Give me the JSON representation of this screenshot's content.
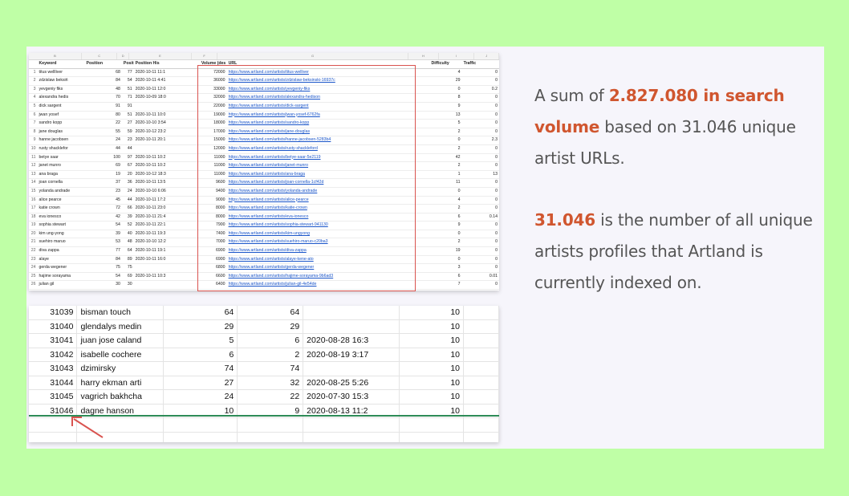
{
  "top_sheet": {
    "column_letters": [
      "B",
      "C",
      "D",
      "E",
      "F",
      "G",
      "H",
      "I",
      "J"
    ],
    "headers": [
      "Keyword",
      "Position",
      "Position His",
      "Position His",
      "Volume (des",
      "URL",
      "Difficulty",
      "Traffic",
      "C"
    ],
    "rows": [
      [
        "1",
        "titus wellliver",
        "68",
        "77",
        "2020-10-11 11:1",
        "72000",
        "https://www.artland.com/artists/titus-welliver",
        "4",
        "0"
      ],
      [
        "2",
        "zdzislaw beksiń",
        "84",
        "54",
        "2020-10-11 4:41",
        "36000",
        "https://www.artland.com/artists/zdzislaw-beksinski-16937c",
        "29",
        "0"
      ],
      [
        "3",
        "yevgeniy fiks",
        "48",
        "51",
        "2020-10-11 12:0",
        "33000",
        "https://www.artland.com/artists/yevgeniy-fiks",
        "0",
        "0.2"
      ],
      [
        "4",
        "alexandra hedis",
        "70",
        "71",
        "2020-10-09 18:0",
        "32000",
        "https://www.artland.com/artists/alexandra-hedison",
        "8",
        "0"
      ],
      [
        "5",
        "dick sargent",
        "91",
        "91",
        "",
        "22000",
        "https://www.artland.com/artists/dick-sargent",
        "9",
        "0"
      ],
      [
        "6",
        "jwan yosef",
        "80",
        "51",
        "2020-10-11 10:0",
        "19000",
        "https://www.artland.com/artists/jwan-yosef-6762fa",
        "13",
        "0"
      ],
      [
        "7",
        "sandro kopp",
        "22",
        "27",
        "2020-10-10 3:54",
        "18000",
        "https://www.artland.com/artists/sandro-kopp",
        "5",
        "0"
      ],
      [
        "8",
        "jane douglas",
        "55",
        "59",
        "2020-10-12 23:2",
        "17000",
        "https://www.artland.com/artists/jane-douglas",
        "2",
        "0"
      ],
      [
        "9",
        "hanne jacobsen",
        "24",
        "23",
        "2020-10-11 20:1",
        "15000",
        "https://www.artland.com/artists/hanne-jacobsen-5283b4",
        "0",
        "2.3"
      ],
      [
        "10",
        "rusty shacklefor",
        "44",
        "44",
        "",
        "12000",
        "https://www.artland.com/artists/rusty-shackleford",
        "2",
        "0"
      ],
      [
        "11",
        "betye saar",
        "100",
        "97",
        "2020-10-11 10:2",
        "11000",
        "https://www.artland.com/artists/betye-saar-5e2119",
        "42",
        "0"
      ],
      [
        "12",
        "janet munro",
        "69",
        "67",
        "2020-10-11 10:2",
        "11000",
        "https://www.artland.com/artists/janet-munro",
        "2",
        "0"
      ],
      [
        "13",
        "ana braga",
        "19",
        "20",
        "2020-10-12 18:3",
        "11000",
        "https://www.artland.com/artists/ana-braga",
        "1",
        "13"
      ],
      [
        "14",
        "joan cornella",
        "37",
        "36",
        "2020-10-11 13:5",
        "9600",
        "https://www.artland.com/artists/joan-cornella-1cf42d",
        "11",
        "0"
      ],
      [
        "15",
        "yolanda andrade",
        "23",
        "24",
        "2020-10-10 6:06",
        "9400",
        "https://www.artland.com/artists/yolanda-andrade",
        "0",
        "0"
      ],
      [
        "16",
        "alice pearce",
        "45",
        "44",
        "2020-10-11 17:2",
        "9000",
        "https://www.artland.com/artists/alice-pearce",
        "4",
        "0"
      ],
      [
        "17",
        "katie crown",
        "72",
        "66",
        "2020-10-11 23:0",
        "8000",
        "https://www.artland.com/artists/katie-crown",
        "2",
        "0"
      ],
      [
        "18",
        "eva ionesco",
        "42",
        "39",
        "2020-10-11 21:4",
        "8000",
        "https://www.artland.com/artists/eva-ionesco",
        "6",
        "0.14"
      ],
      [
        "19",
        "sophia stewart",
        "54",
        "52",
        "2020-10-11 22:1",
        "7900",
        "https://www.artland.com/artists/sophia-stewart-941130",
        "9",
        "0"
      ],
      [
        "20",
        "kim ung-yong",
        "39",
        "40",
        "2020-10-11 19:3",
        "7400",
        "https://www.artland.com/artists/kim-ungyong",
        "0",
        "0"
      ],
      [
        "21",
        "suehiro maruo",
        "53",
        "48",
        "2020-10-10 12:2",
        "7000",
        "https://www.artland.com/artists/suehiro-maruo-c20ba3",
        "2",
        "0"
      ],
      [
        "22",
        "diva zappa",
        "77",
        "64",
        "2020-10-11 19:1",
        "6900",
        "https://www.artland.com/artists/diva-zappa",
        "19",
        "0"
      ],
      [
        "23",
        "alaye",
        "84",
        "89",
        "2020-10-11 16:0",
        "6900",
        "https://www.artland.com/artists/alaye-kene-ato",
        "0",
        "0"
      ],
      [
        "24",
        "gerda wegener",
        "75",
        "75",
        "",
        "6800",
        "https://www.artland.com/artists/gerda-wegener",
        "3",
        "0"
      ],
      [
        "25",
        "hajime sorayama",
        "54",
        "69",
        "2020-10-11 10:3",
        "6600",
        "https://www.artland.com/artists/hajime-sorayama-9b6ad3",
        "6",
        "0.01"
      ],
      [
        "26",
        "julian gil",
        "30",
        "30",
        "",
        "6400",
        "https://www.artland.com/artists/julian-gil-4e54de",
        "7",
        "0"
      ],
      [
        "27",
        "eduardo ramírez",
        "80",
        "83",
        "2020-10-10 14:5",
        "6100",
        "https://www.artland.com/artists/eduardo-ramirez-villamizar-ebd67c",
        "0",
        "0"
      ]
    ]
  },
  "bottom_sheet": {
    "rows": [
      [
        "31039",
        "bisman touch",
        "64",
        "64",
        "",
        "10"
      ],
      [
        "31040",
        "glendalys medin",
        "29",
        "29",
        "",
        "10"
      ],
      [
        "31041",
        "juan jose caland",
        "5",
        "6",
        "2020-08-28 16:3",
        "10"
      ],
      [
        "31042",
        "isabelle cochere",
        "6",
        "2",
        "2020-08-19 3:17",
        "10"
      ],
      [
        "31043",
        "dzimirsky",
        "74",
        "74",
        "",
        "10"
      ],
      [
        "31044",
        "harry ekman arti",
        "27",
        "32",
        "2020-08-25 5:26",
        "10"
      ],
      [
        "31045",
        "vagrich bakhcha",
        "24",
        "22",
        "2020-07-30 15:3",
        "10"
      ],
      [
        "31046",
        "dagne hanson",
        "10",
        "9",
        "2020-08-13 11:2",
        "10"
      ]
    ]
  },
  "text": {
    "p1_before": "A sum of ",
    "p1_highlight": "2.827.080 in search volume",
    "p1_after": " based on 31.046 unique artist URLs.",
    "p2_highlight": "31.046",
    "p2_after": " is the number of all unique artists profiles that Artland is currently indexed on."
  },
  "colors": {
    "background": "#bfffa6",
    "card": "#f6f5fb",
    "highlight": "#d0562f",
    "annotation_red": "#d9534f"
  }
}
